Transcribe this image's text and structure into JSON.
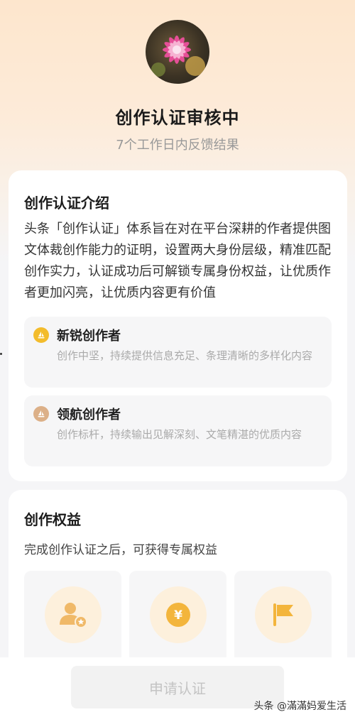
{
  "header": {
    "status_title": "创作认证审核中",
    "status_subtitle": "7个工作日内反馈结果"
  },
  "intro": {
    "title": "创作认证介绍",
    "text": "头条「创作认证」体系旨在对在平台深耕的作者提供图文体裁创作能力的证明，设置两大身份层级，精准匹配创作实力，认证成功后可解锁专属身份权益，让优质作者更加闪亮，让优质内容更有价值",
    "tiers": [
      {
        "name": "新锐创作者",
        "desc": "创作中坚，持续提供信息充足、条理清晰的多样化内容",
        "icon": "sailboat-icon",
        "color": "#f3bc2c"
      },
      {
        "name": "领航创作者",
        "desc": "创作标杆，持续输出见解深刻、文笔精湛的优质内容",
        "icon": "sailboat-icon",
        "color": "#dcb088"
      }
    ]
  },
  "rights": {
    "title": "创作权益",
    "subtitle": "完成创作认证之后，可获得专属权益",
    "perks": [
      {
        "icon": "user-star-icon"
      },
      {
        "icon": "yuan-coin-icon"
      },
      {
        "icon": "flag-icon"
      }
    ]
  },
  "footer": {
    "apply_label": "申请认证",
    "watermark": "头条 @滿滿妈爱生活"
  },
  "colors": {
    "accent_gold": "#f3bc2c",
    "accent_bronze": "#dcb088",
    "hero_gradient_top": "#fde6cd"
  }
}
